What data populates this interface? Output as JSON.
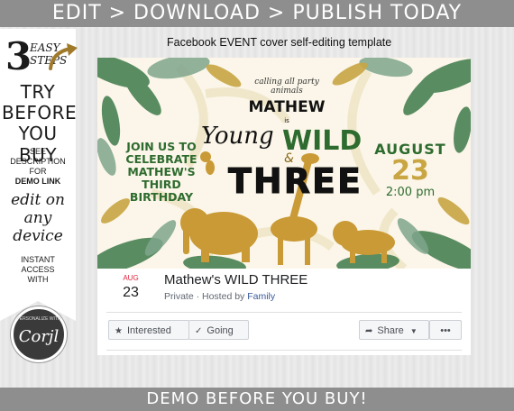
{
  "top_banner": "EDIT > DOWNLOAD > PUBLISH TODAY",
  "subtitle": "Facebook EVENT cover self-editing template",
  "ribbon": {
    "number": "3",
    "easy": "EASY",
    "steps": "STEPS",
    "try": "TRY",
    "before": "BEFORE",
    "you_buy": "YOU BUY",
    "see": "SEE",
    "description": "DESCRIPTION",
    "for": "FOR",
    "demo_link": "DEMO LINK",
    "edit_on": "edit on",
    "any": "any",
    "device": "device",
    "instant": "INSTANT",
    "access": "ACCESS",
    "with": "WITH",
    "badge_ring": "PERSONALIZE WITH",
    "badge_name": "Corjl"
  },
  "cover": {
    "calling": "calling all party animals",
    "name": "MATHEW",
    "is": "is",
    "young": "Young",
    "wild": "WILD",
    "amp": "&",
    "three": "THREE",
    "join_lines": [
      "JOIN US TO",
      "CELEBRATE",
      "MATHEW'S",
      "THIRD",
      "BIRTHDAY"
    ],
    "month": "AUGUST",
    "day": "23",
    "time": "2:00 pm"
  },
  "event": {
    "month": "AUG",
    "day": "23",
    "title": "Mathew's WILD THREE",
    "meta_prefix": "Private · Hosted by ",
    "host": "Family",
    "interested": "Interested",
    "going": "Going",
    "share": "Share",
    "more": "•••"
  },
  "bottom_banner": "DEMO BEFORE YOU BUY!",
  "colors": {
    "banner": "#8e8e8e",
    "green": "#2e6b2f",
    "gold": "#c9a643",
    "fb_link": "#385898",
    "fb_date": "#e0243d"
  }
}
